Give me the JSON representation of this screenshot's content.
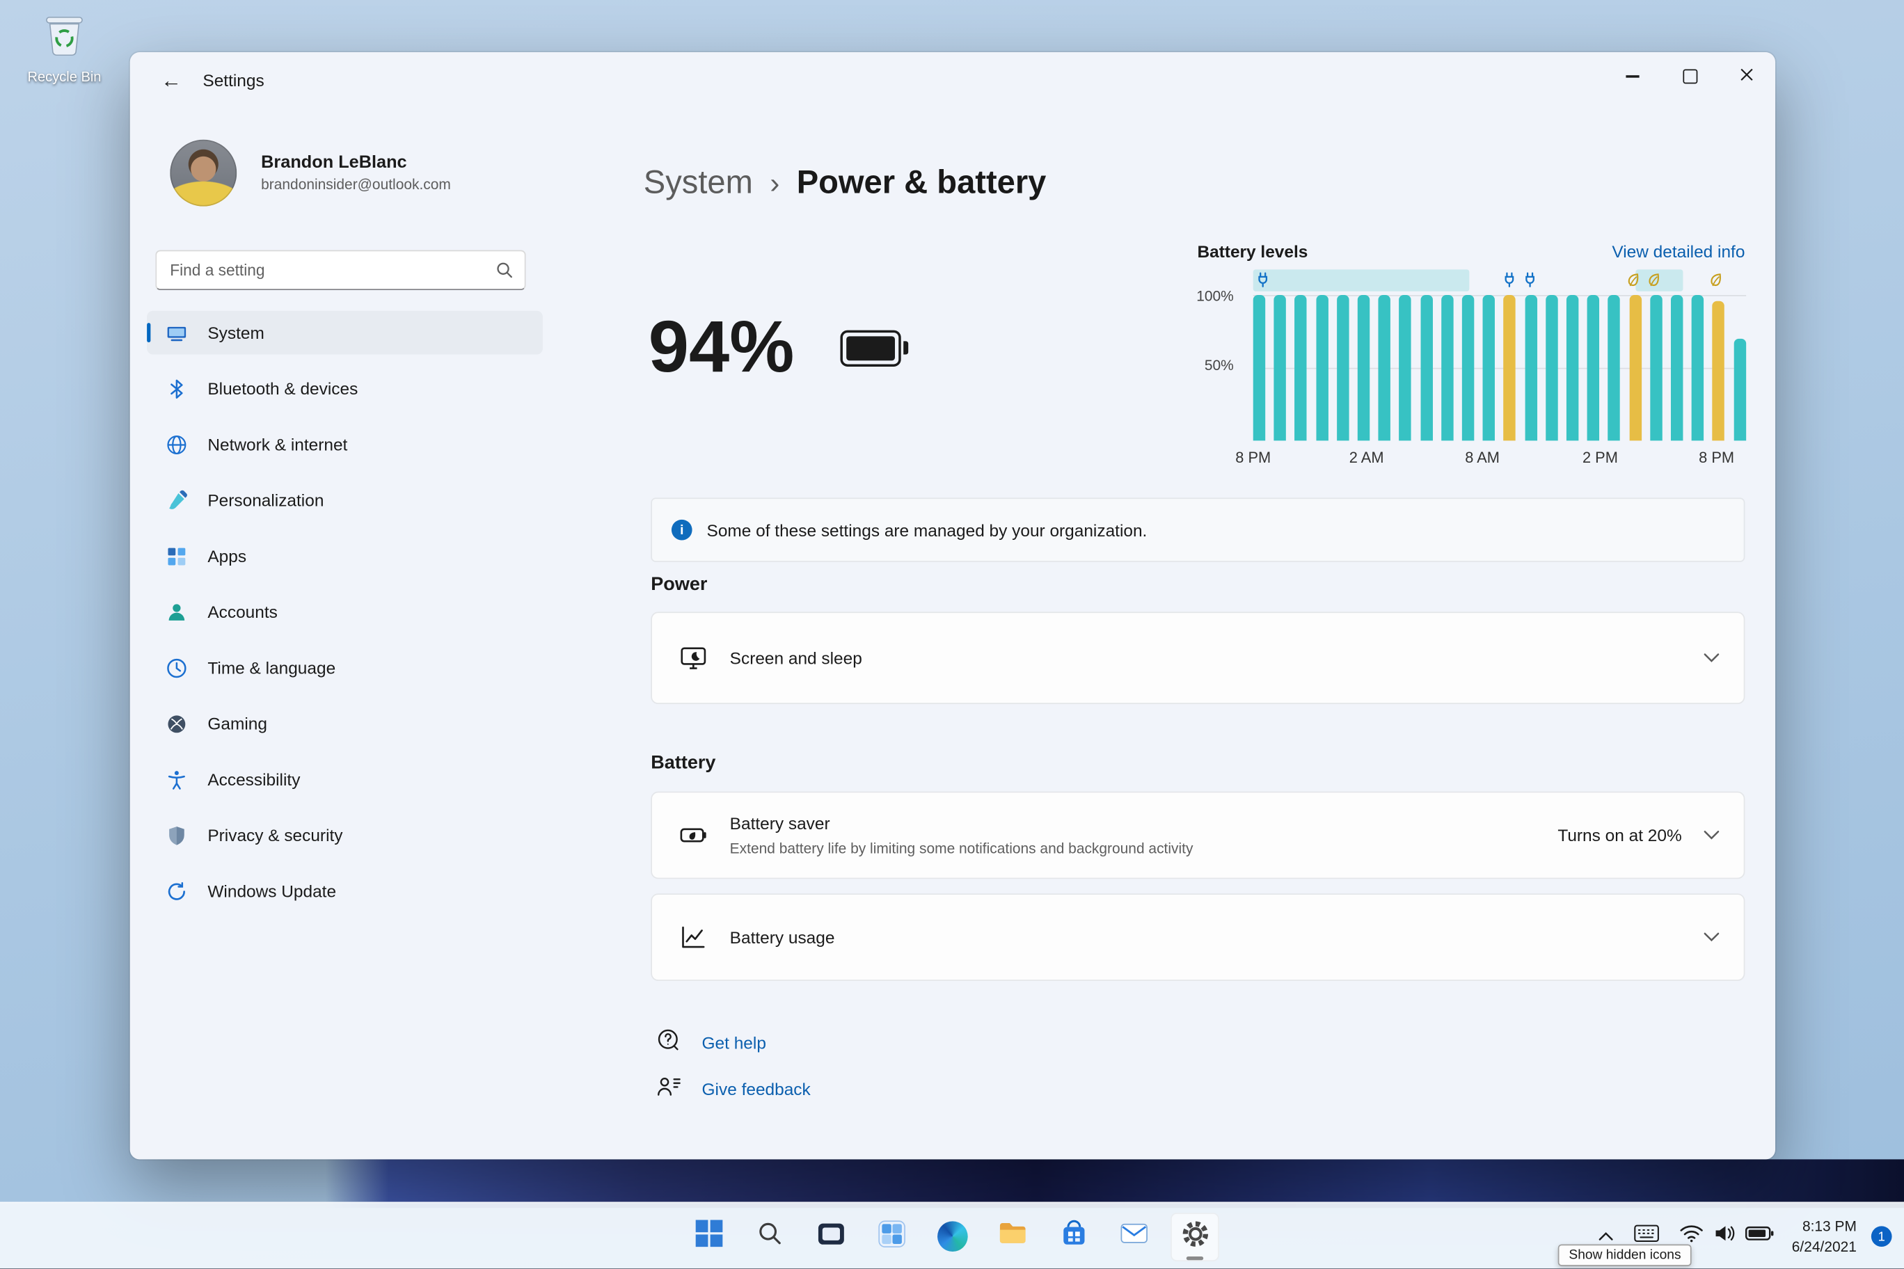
{
  "desktop": {
    "recycle_bin_label": "Recycle Bin"
  },
  "window": {
    "title": "Settings"
  },
  "glyphs": {
    "back_arrow": "←",
    "breadcrumb_separator": "›",
    "info": "i"
  },
  "colors": {
    "accent": "#0067c0",
    "link": "#0b5fae"
  },
  "profile": {
    "name": "Brandon LeBlanc",
    "email": "brandoninsider@outlook.com"
  },
  "search": {
    "placeholder": "Find a setting"
  },
  "sidebar": {
    "items": [
      {
        "label": "System",
        "icon": "system-icon",
        "selected": true
      },
      {
        "label": "Bluetooth & devices",
        "icon": "bluetooth-icon"
      },
      {
        "label": "Network & internet",
        "icon": "network-icon"
      },
      {
        "label": "Personalization",
        "icon": "personalization-icon"
      },
      {
        "label": "Apps",
        "icon": "apps-icon"
      },
      {
        "label": "Accounts",
        "icon": "accounts-icon"
      },
      {
        "label": "Time & language",
        "icon": "time-language-icon"
      },
      {
        "label": "Gaming",
        "icon": "gaming-icon"
      },
      {
        "label": "Accessibility",
        "icon": "accessibility-icon"
      },
      {
        "label": "Privacy & security",
        "icon": "privacy-icon"
      },
      {
        "label": "Windows Update",
        "icon": "windows-update-icon"
      }
    ]
  },
  "breadcrumb": {
    "parent": "System",
    "current": "Power & battery"
  },
  "battery_summary": {
    "percent": "94%"
  },
  "chart_data": {
    "type": "bar",
    "title": "Battery levels",
    "link_label": "View detailed info",
    "ylim": [
      0,
      100
    ],
    "y_tick_labels": [
      "100%",
      "50%"
    ],
    "x_tick_labels": [
      "8 PM",
      "2 AM",
      "8 AM",
      "2 PM",
      "8 PM"
    ],
    "palette": {
      "normal": "#37c2c3",
      "saver": "#e7bd45"
    },
    "marker_colors": {
      "plug": "#1271c6",
      "eco": "#c79f1e"
    },
    "bars": [
      {
        "value": 100,
        "state": "normal"
      },
      {
        "value": 100,
        "state": "normal"
      },
      {
        "value": 100,
        "state": "normal"
      },
      {
        "value": 100,
        "state": "normal"
      },
      {
        "value": 100,
        "state": "normal"
      },
      {
        "value": 100,
        "state": "normal"
      },
      {
        "value": 100,
        "state": "normal"
      },
      {
        "value": 100,
        "state": "normal"
      },
      {
        "value": 100,
        "state": "normal"
      },
      {
        "value": 100,
        "state": "normal"
      },
      {
        "value": 100,
        "state": "normal"
      },
      {
        "value": 100,
        "state": "normal"
      },
      {
        "value": 100,
        "state": "saver"
      },
      {
        "value": 100,
        "state": "normal"
      },
      {
        "value": 100,
        "state": "normal"
      },
      {
        "value": 100,
        "state": "normal"
      },
      {
        "value": 100,
        "state": "normal"
      },
      {
        "value": 100,
        "state": "normal"
      },
      {
        "value": 100,
        "state": "saver"
      },
      {
        "value": 100,
        "state": "normal"
      },
      {
        "value": 100,
        "state": "normal"
      },
      {
        "value": 100,
        "state": "normal"
      },
      {
        "value": 96,
        "state": "saver"
      },
      {
        "value": 70,
        "state": "normal"
      }
    ],
    "markers": [
      {
        "i": 0,
        "type": "plug"
      },
      {
        "i": 12,
        "type": "plug"
      },
      {
        "i": 13,
        "type": "plug"
      },
      {
        "i": 18,
        "type": "eco"
      },
      {
        "i": 19,
        "type": "eco"
      },
      {
        "i": 22,
        "type": "eco"
      }
    ],
    "charge_bands": [
      {
        "from": 0,
        "to": 10.5
      },
      {
        "from": 18.6,
        "to": 20.9
      }
    ]
  },
  "banner": {
    "text": "Some of these settings are managed by your organization."
  },
  "sections": {
    "power": {
      "heading": "Power",
      "cards": [
        {
          "title": "Screen and sleep"
        }
      ]
    },
    "battery": {
      "heading": "Battery",
      "cards": [
        {
          "title": "Battery saver",
          "subtitle": "Extend battery life by limiting some notifications and background activity",
          "value": "Turns on at 20%"
        },
        {
          "title": "Battery usage"
        }
      ]
    }
  },
  "links": {
    "get_help": "Get help",
    "give_feedback": "Give feedback"
  },
  "taskbar": {
    "app_icons": [
      "start",
      "search",
      "task-view",
      "widgets",
      "edge",
      "file-explorer",
      "microsoft-store",
      "mail",
      "settings"
    ],
    "tray_icons": [
      "chevron-up",
      "touch-keyboard",
      "wifi",
      "volume",
      "battery"
    ],
    "tooltip": "Show hidden icons",
    "clock": {
      "time": "8:13 PM",
      "date": "6/24/2021"
    },
    "badge": "1"
  }
}
